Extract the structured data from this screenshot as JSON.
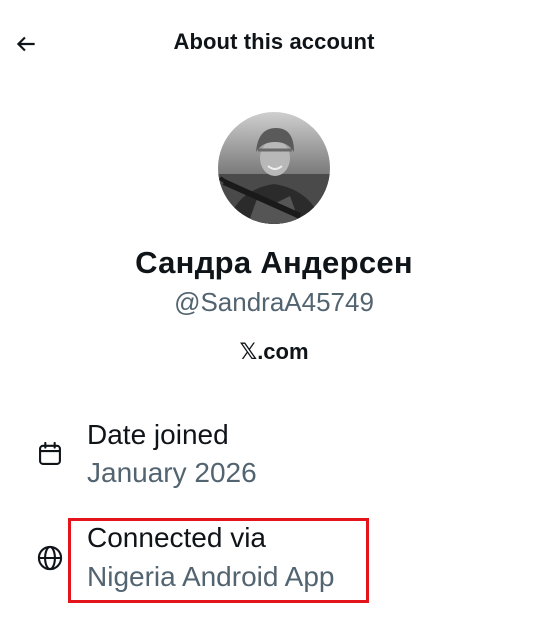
{
  "header": {
    "title": "About this account",
    "back_icon": "arrow-left-icon"
  },
  "profile": {
    "avatar_icon": "profile-photo",
    "display_name": "Сандра Андерсен",
    "handle": "@SandraA45749",
    "platform_logo": "𝕏",
    "platform_suffix": ".com"
  },
  "details": {
    "date_joined": {
      "icon": "calendar-icon",
      "label": "Date joined",
      "value": "January 2026"
    },
    "connected_via": {
      "icon": "globe-icon",
      "label": "Connected via",
      "value": "Nigeria Android App"
    }
  },
  "colors": {
    "text_primary": "#0f1419",
    "text_secondary": "#536471",
    "highlight": "#e3151a"
  }
}
